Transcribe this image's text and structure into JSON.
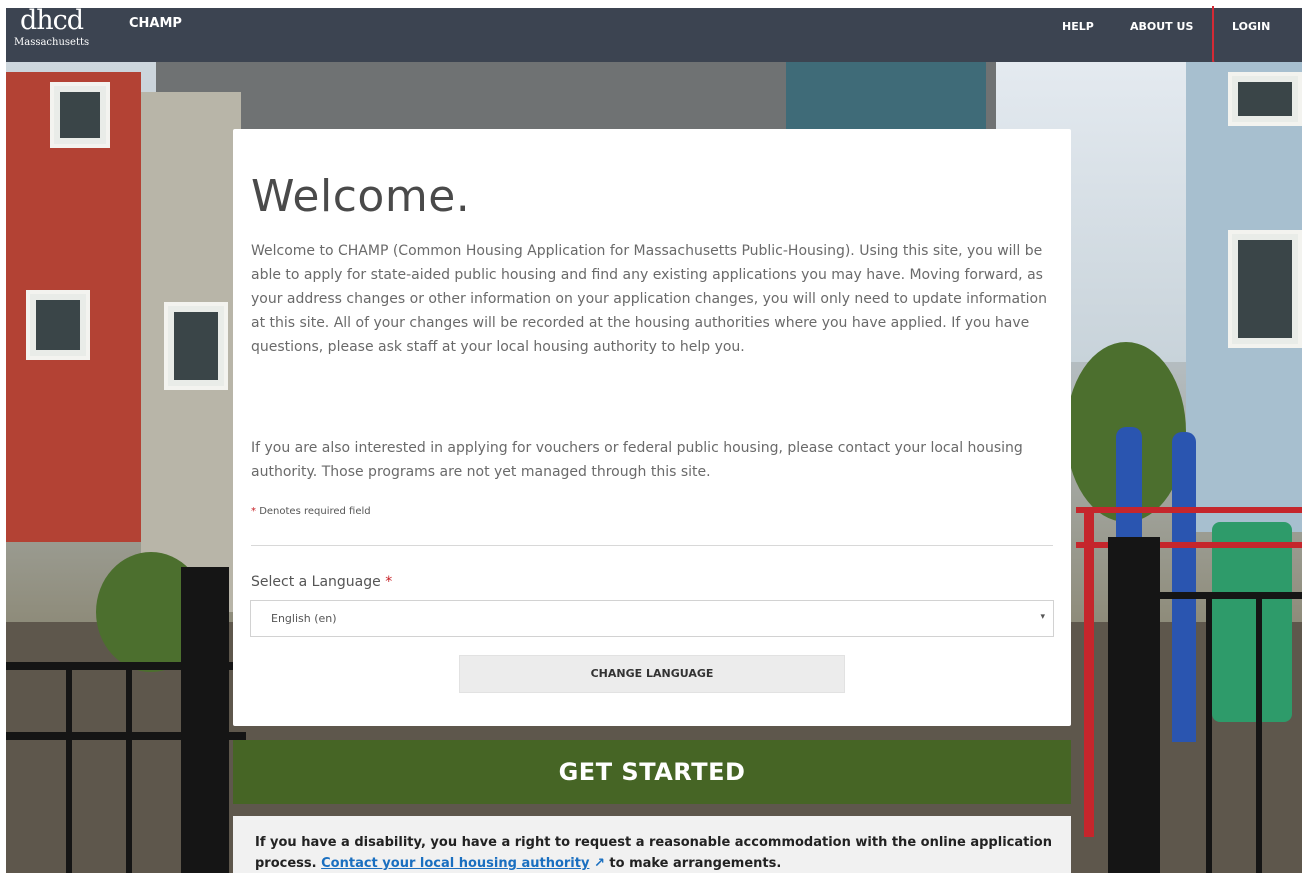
{
  "navbar": {
    "brand_name": "dhcd",
    "brand_sub": "Massachusetts",
    "app_name": "CHAMP",
    "links": {
      "help": "HELP",
      "about": "ABOUT US",
      "login": "LOGIN"
    }
  },
  "welcome": {
    "title": "Welcome.",
    "intro": "Welcome to CHAMP (Common Housing Application for Massachusetts Public-Housing). Using this site, you will be able to apply for state-aided public housing and find any existing applications you may have. Moving forward, as your address changes or other information on your application changes, you will only need to update information at this site. All of your changes will be recorded at the housing authorities where you have applied. If you have questions, please ask staff at your local housing authority to help you.",
    "intro2": "If you are also interested in applying for vouchers or federal public housing, please contact your local housing authority. Those programs are not yet managed through this site.",
    "required_star": "*",
    "required_note": "Denotes required field"
  },
  "language": {
    "label": "Select a Language",
    "required_star": "*",
    "selected": "English (en)",
    "caret": "▾",
    "change_button": "CHANGE LANGUAGE"
  },
  "get_started": "GET STARTED",
  "disability": {
    "text_before": "If you have a disability, you have a right to request a reasonable accommodation with the online application process. ",
    "link_text": "Contact your local housing authority",
    "link_icon": "external-link-icon",
    "text_after": " to make arrangements."
  },
  "colors": {
    "navbar": "#3c4451",
    "get_started": "#466525",
    "link": "#1a6fc0",
    "required": "#c62026",
    "login_highlight": "#d42a35"
  }
}
